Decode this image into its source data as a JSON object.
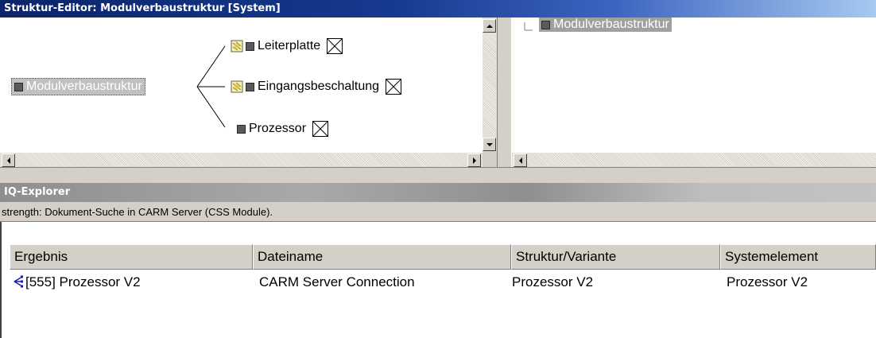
{
  "structure_editor": {
    "title": "Struktur-Editor: Modulverbaustruktur [System]",
    "tree": {
      "root": "Modulverbaustruktur",
      "children": [
        {
          "label": "Leiterplatte",
          "has_document": true
        },
        {
          "label": "Eingangsbeschaltung",
          "has_document": true
        },
        {
          "label": "Prozessor",
          "has_document": false
        }
      ]
    },
    "list": {
      "items": [
        "Modulverbaustruktur"
      ]
    }
  },
  "iq_explorer": {
    "title": "IQ-Explorer",
    "search_status": "strength: Dokument-Suche in CARM Server (CSS Module).",
    "table": {
      "columns": [
        "Ergebnis",
        "Dateiname",
        "Struktur/Variante",
        "Systemelement"
      ],
      "rows": [
        {
          "ergebnis": "[555]  Prozessor V2",
          "dateiname": "CARM Server Connection",
          "struktur": "Prozessor V2",
          "systemelement": "Prozessor V2"
        }
      ]
    }
  },
  "colors": {
    "title_active_start": "#0b246a",
    "title_active_end": "#a6caf0",
    "title_inactive": "#a9a9a9",
    "panel_face": "#d4d0c8",
    "selection_gray": "#a0a0a0"
  },
  "icons": {
    "node_square": "gray-square-icon",
    "document": "document-icon",
    "no_link": "x-box-icon",
    "result": "tree-hierarchy-icon"
  }
}
